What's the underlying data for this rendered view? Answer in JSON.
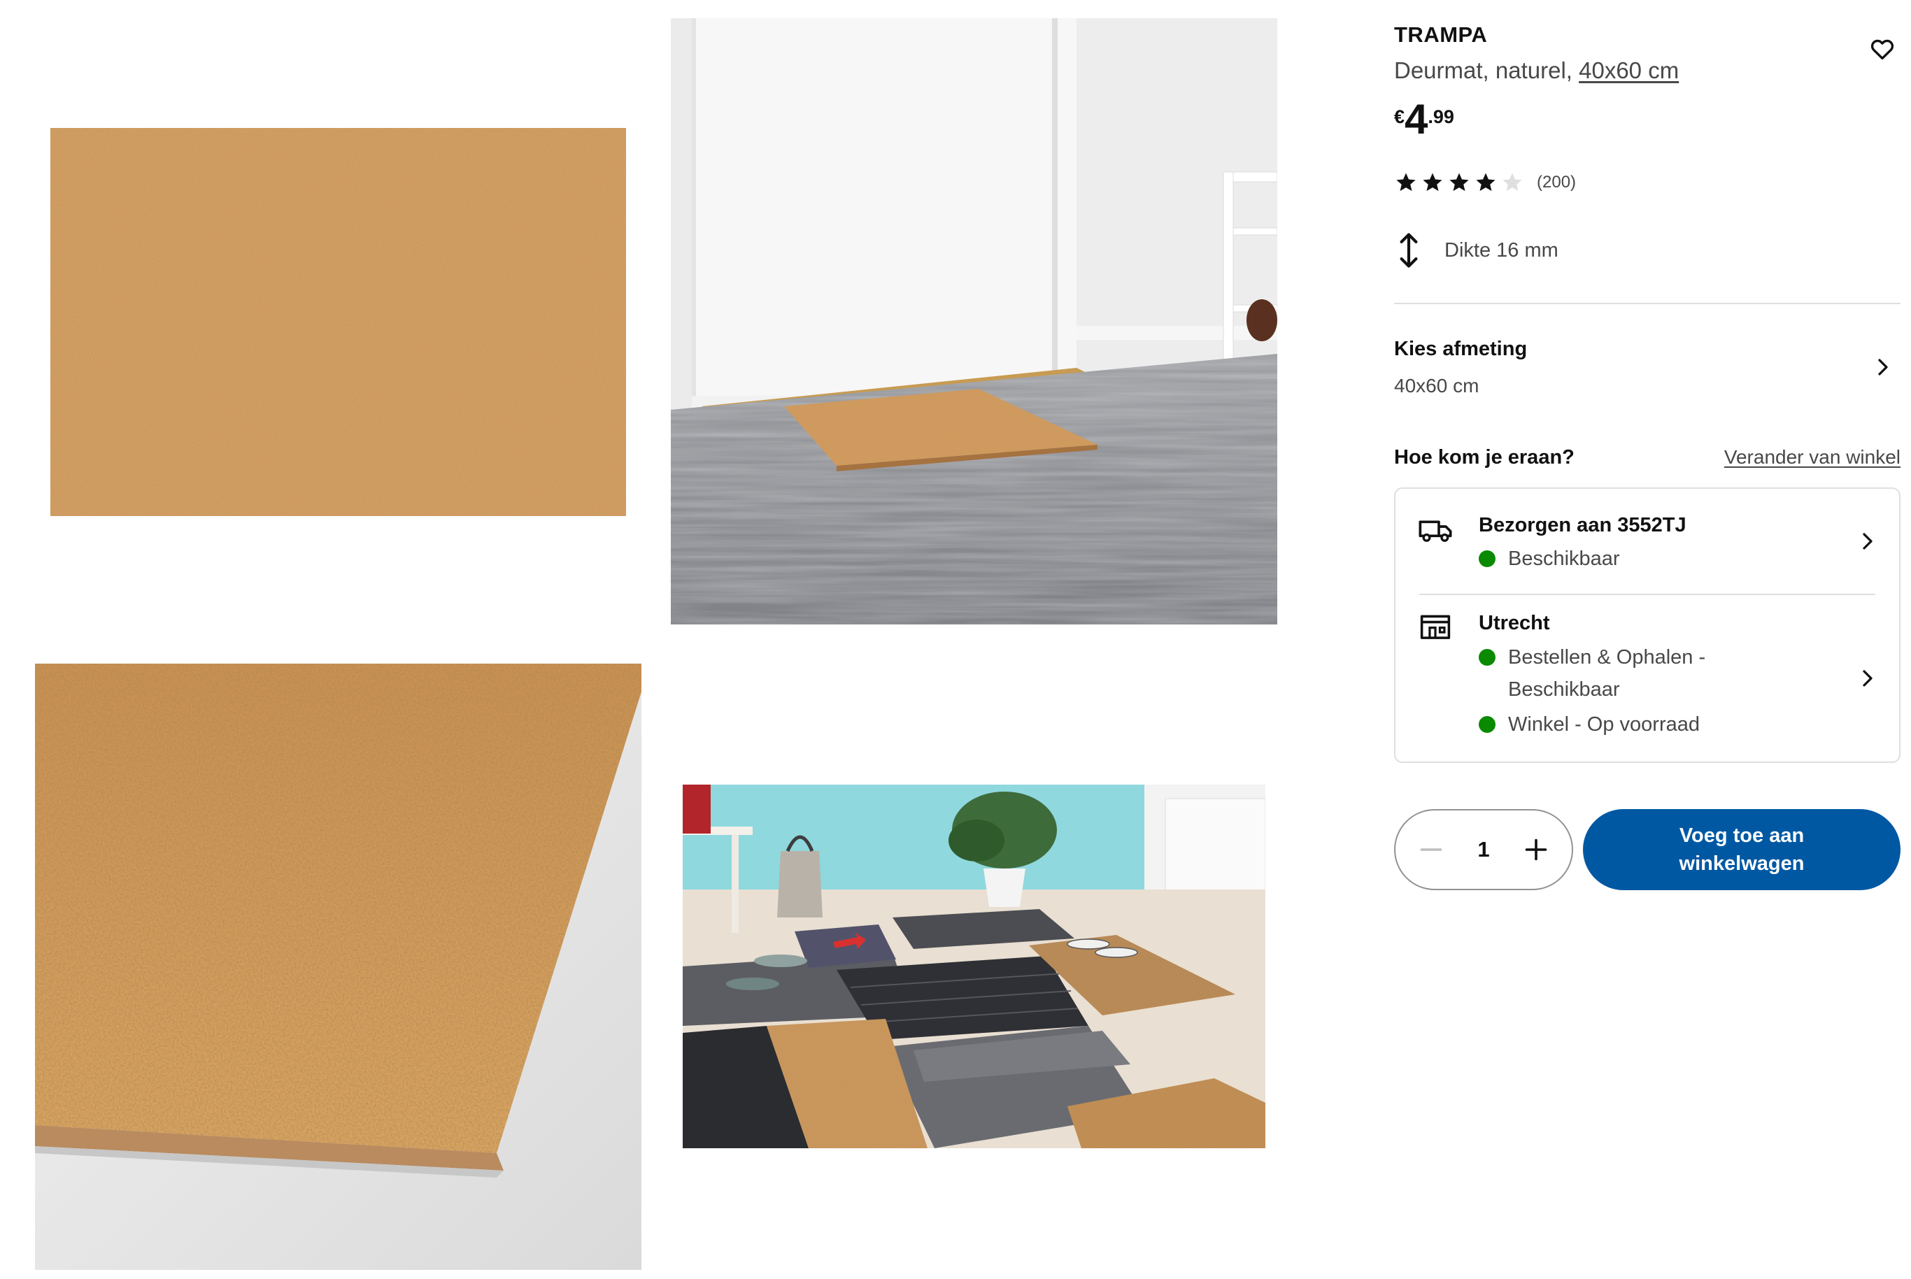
{
  "gallery": {
    "images": [
      {
        "name": "product-image-mat-front"
      },
      {
        "name": "product-image-mat-at-door"
      },
      {
        "name": "product-image-mat-closeup"
      },
      {
        "name": "product-image-mats-hallway"
      }
    ]
  },
  "product": {
    "name": "TRAMPA",
    "description_prefix": "Deurmat, naturel, ",
    "size_link": "40x60 cm",
    "price": {
      "currency": "€",
      "integer": "4",
      "decimal": ".99"
    },
    "rating": {
      "stars": 4,
      "max": 5,
      "count_label": "(200)"
    },
    "thickness_label": "Dikte 16 mm",
    "favorite_icon": "heart-outline-icon"
  },
  "size_selector": {
    "title": "Kies afmeting",
    "value": "40x60 cm"
  },
  "fulfillment": {
    "title": "Hoe kom je eraan?",
    "change_store_label": "Verander van winkel",
    "delivery": {
      "title": "Bezorgen aan 3552TJ",
      "status": "Beschikbaar",
      "icon": "truck-icon"
    },
    "store": {
      "title": "Utrecht",
      "status1": "Bestellen & Ophalen - Beschikbaar",
      "status2": "Winkel - Op voorraad",
      "icon": "store-icon"
    },
    "status_color": "#0a8a00"
  },
  "cart": {
    "quantity": "1",
    "add_label": "Voeg toe aan winkelwagen",
    "button_color": "#0058a3"
  }
}
